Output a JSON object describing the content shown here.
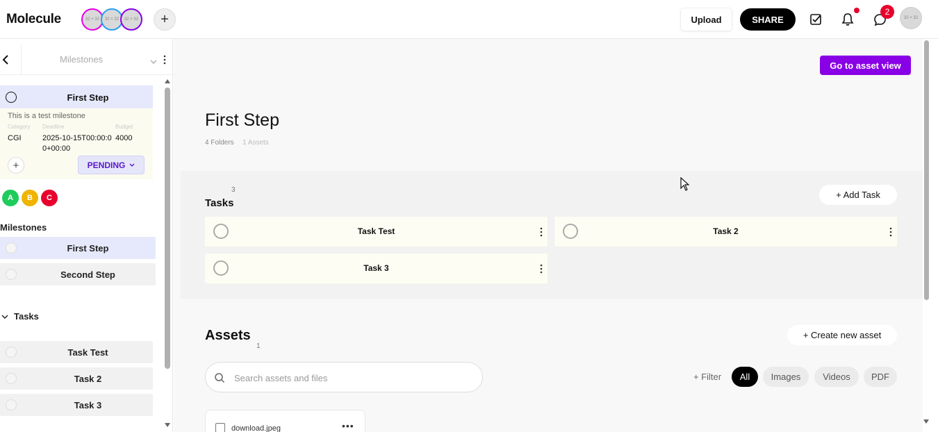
{
  "app": {
    "name": "Molecule"
  },
  "header": {
    "collaborators": [
      {
        "label": "32 × 32",
        "color": "#e600e6"
      },
      {
        "label": "32 × 32",
        "color": "#2a9df4"
      },
      {
        "label": "32 × 32",
        "color": "#8a00e6"
      }
    ],
    "upload_label": "Upload",
    "share_label": "SHARE",
    "messages_count": "2",
    "user_avatar_label": "32 × 32",
    "icons": [
      "plus-icon",
      "tasks-check-icon",
      "bell-icon",
      "chat-icon"
    ]
  },
  "sidebar": {
    "selector_label": "Milestones",
    "selected_milestone": {
      "title": "First Step",
      "description": "This is a test milestone",
      "fields": [
        {
          "label": "Category",
          "value": "CGI"
        },
        {
          "label": "Deadline",
          "value": "2025-10-15T00:00:00+00:00"
        },
        {
          "label": "Budget",
          "value": "4000"
        }
      ],
      "status": "PENDING"
    },
    "assignees": [
      {
        "initial": "A",
        "color": "#1fcc5b"
      },
      {
        "initial": "B",
        "color": "#f0b400"
      },
      {
        "initial": "C",
        "color": "#e8002d"
      }
    ],
    "milestones_heading": "Milestones",
    "milestones": [
      "First Step",
      "Second Step"
    ],
    "tasks_heading": "Tasks",
    "tasks": [
      "Task Test",
      "Task 2",
      "Task 3"
    ]
  },
  "main": {
    "go_to_asset_view_label": "Go to asset view",
    "title": "First Step",
    "folders_count": "4 Folders",
    "assets_meta": "1 Assets",
    "tasks": {
      "heading": "Tasks",
      "count": "3",
      "add_label": "+ Add Task",
      "items": [
        "Task Test",
        "Task 2",
        "Task 3"
      ]
    },
    "assets": {
      "heading": "Assets",
      "count": "1",
      "create_label": "+ Create new asset",
      "search_placeholder": "Search assets and files",
      "filter_label": "+ Filter",
      "chips": [
        "All",
        "Images",
        "Videos",
        "PDF"
      ],
      "active_chip": "All",
      "files": [
        "download.jpeg"
      ]
    }
  },
  "colors": {
    "accent_purple": "#8a00e6",
    "status_purple": "#5a19c9",
    "alert_red": "#e8002d"
  }
}
